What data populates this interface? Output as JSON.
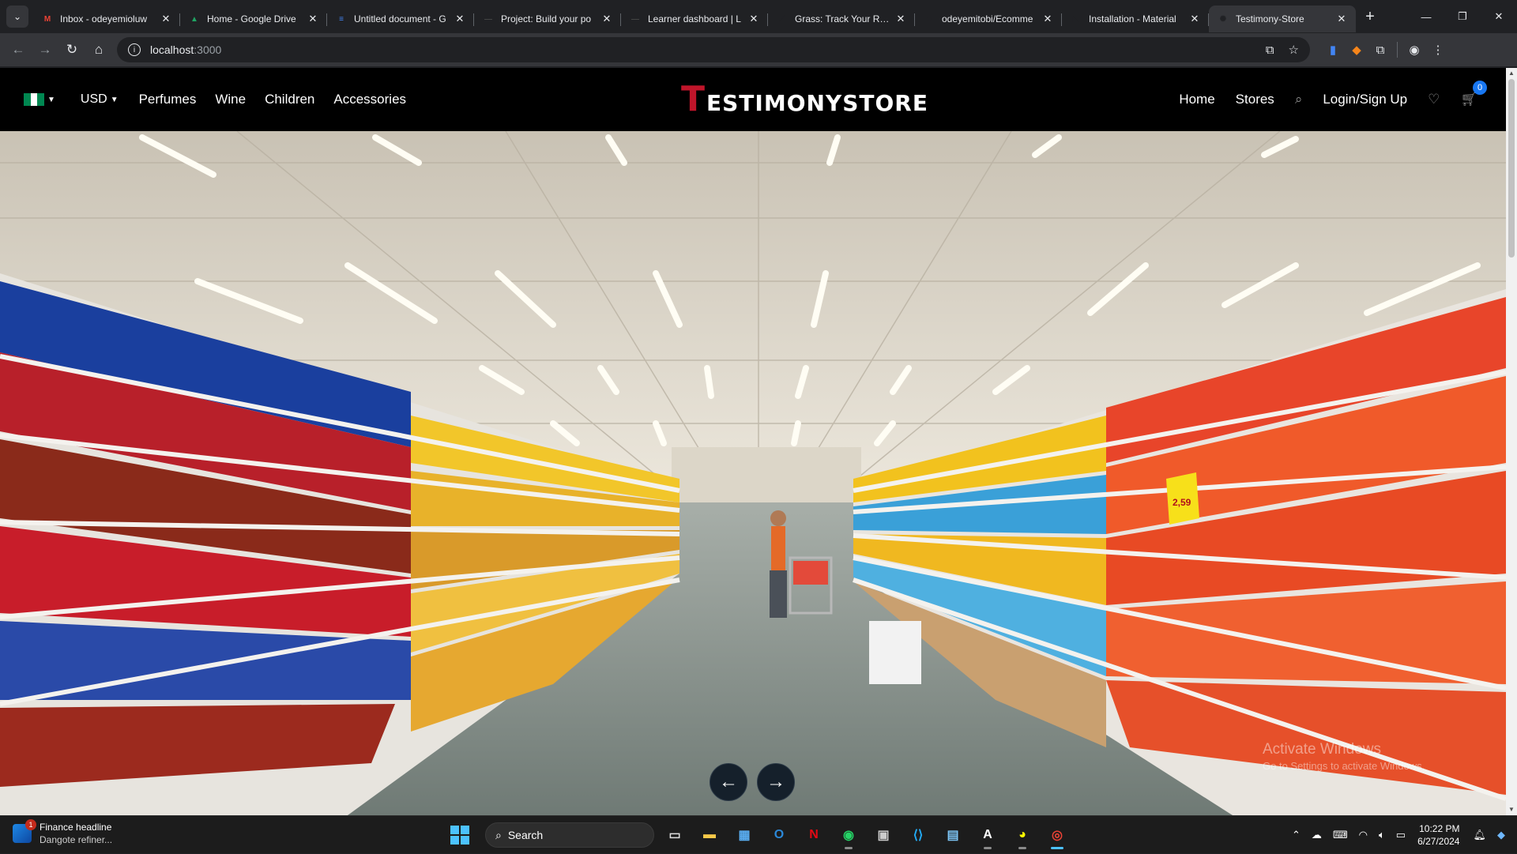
{
  "browser": {
    "tabs": [
      {
        "title": "Inbox - odeyemioluw",
        "icon": "gmail-icon",
        "fav_color": "#ea4335",
        "fav_glyph": "M"
      },
      {
        "title": "Home - Google Drive",
        "icon": "google-drive-icon",
        "fav_color": "#1fa463",
        "fav_glyph": "▲"
      },
      {
        "title": "Untitled document - G",
        "icon": "google-docs-icon",
        "fav_color": "#4285f4",
        "fav_glyph": "≡"
      },
      {
        "title": "Project: Build your po",
        "icon": "project-icon",
        "fav_color": "#444",
        "fav_glyph": "—"
      },
      {
        "title": "Learner dashboard | L",
        "icon": "learner-icon",
        "fav_color": "#444",
        "fav_glyph": "—"
      },
      {
        "title": "Grass: Track Your Rew",
        "icon": "grass-icon",
        "fav_color": "#202124",
        "fav_glyph": "⟋"
      },
      {
        "title": "odeyemitobi/Ecomme",
        "icon": "github-icon",
        "fav_color": "#202124",
        "fav_glyph": "●"
      },
      {
        "title": "Installation - Material",
        "icon": "material-ui-icon",
        "fav_color": "#202124",
        "fav_glyph": "◣"
      },
      {
        "title": "Testimony-Store",
        "icon": "react-icon",
        "fav_color": "#202124",
        "fav_glyph": "✺",
        "active": true
      }
    ],
    "address": {
      "host": "localhost",
      "port": ":3000"
    }
  },
  "site": {
    "currency": "USD",
    "nav_left": [
      "Perfumes",
      "Wine",
      "Children",
      "Accessories"
    ],
    "logo": {
      "first": "T",
      "rest": "ESTIMONYSTORE"
    },
    "nav_right": [
      "Home",
      "Stores"
    ],
    "login": "Login/Sign Up",
    "cart_count": "0",
    "colors": {
      "brand_red": "#c0152a",
      "badge_blue": "#1877f2",
      "header_bg": "#000000"
    }
  },
  "hero": {
    "image_subject": "supermarket aisle with cereal and beverage shelves",
    "price_tag": "2,59",
    "prev_icon": "arrow-left-icon",
    "next_icon": "arrow-right-icon"
  },
  "watermark": {
    "title": "Activate Windows",
    "subtitle": "Go to Settings to activate Windows."
  },
  "taskbar": {
    "news_title": "Finance headline",
    "news_sub": "Dangote refiner...",
    "news_badge": "1",
    "search_placeholder": "Search",
    "time": "10:22 PM",
    "date": "6/27/2024"
  }
}
